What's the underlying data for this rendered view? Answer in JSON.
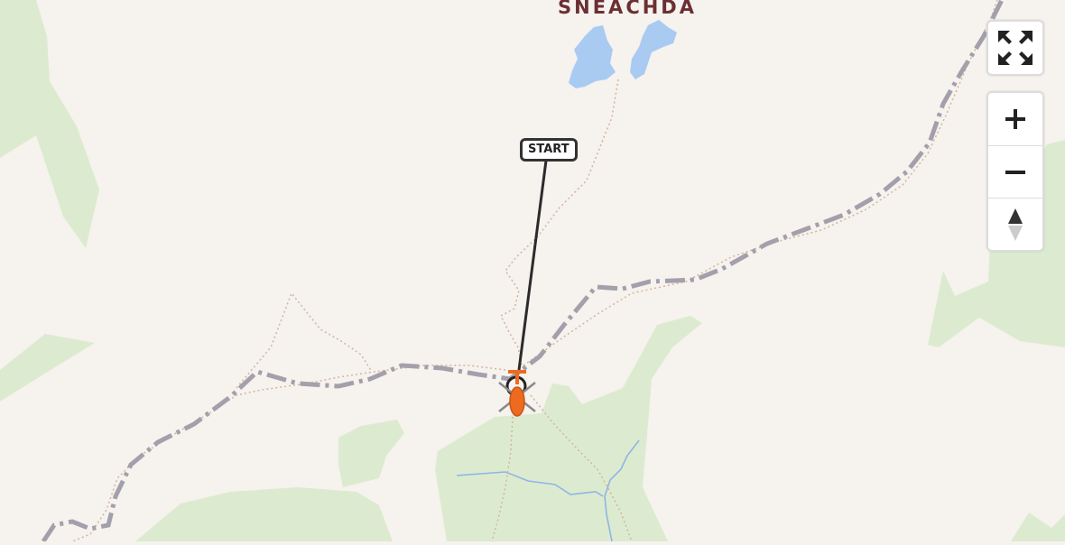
{
  "map": {
    "place_label": "SNEACHDA",
    "start_label": "START"
  },
  "controls": {
    "fullscreen_icon": "fullscreen-icon",
    "zoom_in_icon": "plus-icon",
    "zoom_out_icon": "minus-icon",
    "compass_icon": "compass-north-icon"
  },
  "colors": {
    "background": "#f6f2ee",
    "forest": "#dcebcf",
    "water": "#a9cbf2",
    "rail": "#a3a0ac",
    "route": "#2b2b2b",
    "helicopter": "#ee6a1f",
    "place_label": "#6b2f33"
  }
}
